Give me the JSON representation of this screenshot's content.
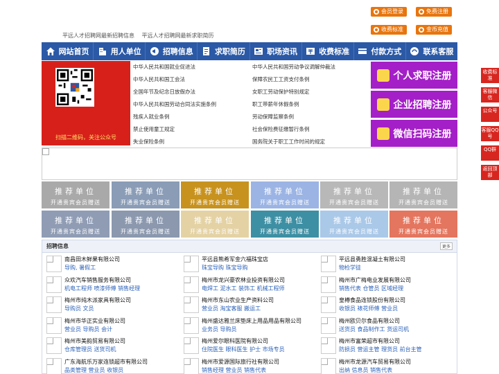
{
  "top": {
    "links": [
      "平远人才招聘网最新招聘信息",
      "平远人才招聘网最新求职简历"
    ],
    "buttons": [
      "会员登录",
      "免费注册",
      "收费标准",
      "金币充值"
    ]
  },
  "nav": [
    "网站首页",
    "用人单位",
    "招聘信息",
    "求职简历",
    "职场资讯",
    "收费标准",
    "付款方式",
    "联系客服"
  ],
  "qr": {
    "caption": "扫描二维码，关注公众号"
  },
  "laws": {
    "left": [
      "中华人民共和国就业促进法",
      "中华人民共和国工会法",
      "全国年节及纪念日放假办法",
      "中华人民共和国劳动合同法实施条例",
      "残疾人就业条例",
      "禁止使用童工规定",
      "失业保险条例"
    ],
    "right": [
      "中华人民共和国劳动争议调解仲裁法",
      "保障农民工工资支付条例",
      "女职工劳动保护特别规定",
      "职工带薪年休假条例",
      "劳动保障监察条例",
      "社会保险费征缴暂行条例",
      "国务院关于职工工作时间的规定"
    ]
  },
  "register": [
    "个人求职注册",
    "企业招聘注册",
    "微信扫码注册"
  ],
  "tiles": {
    "title": "推荐单位",
    "sub": "开通贵宾会员赠送",
    "colors": [
      "#a9a9a9",
      "#8a9cb6",
      "#c7921e",
      "#9bb4e4",
      "#b8b8b8",
      "#b5b5b5",
      "#8f9cb4",
      "#8b98ae",
      "#e4d2a4",
      "#3d8fa3",
      "#aac8e8",
      "#e4755e"
    ]
  },
  "jobs": {
    "title": "招聘信息",
    "more": "更多",
    "items": [
      {
        "name": "南昌田木鲜果有限公司",
        "tags": "导购, 暑假工"
      },
      {
        "name": "平远县熊希军金六福珠宝店",
        "tags": "珠宝导购 珠宝导购"
      },
      {
        "name": "平远县勇胜混凝土有限公司",
        "tags": "物检学徒"
      },
      {
        "name": "众欢汽车销售服务有限公司",
        "tags": "机电工程师 喷漆师傅 销售经理"
      },
      {
        "name": "梅州市龙兴豪农林业投资有限公司",
        "tags": "电焊工 泥水工 装饰工 机械工程师"
      },
      {
        "name": "梅州市广梅电业发展有限公司",
        "tags": "销售代表 仓管员 区域经理"
      },
      {
        "name": "梅州市纯木派家具有限公司",
        "tags": "导购员 文员"
      },
      {
        "name": "梅州市东山农业生产资料公司",
        "tags": "营业员 淘宝客服 搬运工"
      },
      {
        "name": "皇樽食品连锁股份有限公司",
        "tags": "收银员 裱花师傅 营业员"
      },
      {
        "name": "梅州市华正实业有限公司",
        "tags": "营业员 导购员 会计"
      },
      {
        "name": "梅州盛达雅兰床垫床上用品用品有限公司",
        "tags": "业务员 导购员"
      },
      {
        "name": "梅州欧贝尔食品有限公司",
        "tags": "送货员 食品制作工 货运司机"
      },
      {
        "name": "梅州市美韵贸易有限公司",
        "tags": "仓库管理员 送货司机"
      },
      {
        "name": "梅州爱尔眼科医院有限公司",
        "tags": "住院医生 眼科医生 护士 市场专员"
      },
      {
        "name": "梅州市富荣超市有限公司",
        "tags": "防损员 营运主管 理货员 前台主管"
      },
      {
        "name": "广东海航乐万家连锁超市有限公司",
        "tags": "品类管理 营业员 收银员"
      },
      {
        "name": "梅州市爱源国际旅行社有限公司",
        "tags": "销售经理 营业员 销售代表"
      },
      {
        "name": "梅州市龙源汽车贸易有限公司",
        "tags": "出纳 信息员 销售代表"
      }
    ]
  },
  "side": [
    "收费标准",
    "客服微信",
    "公众号",
    "客服QQ号",
    "QQ群",
    "返回顶部"
  ]
}
